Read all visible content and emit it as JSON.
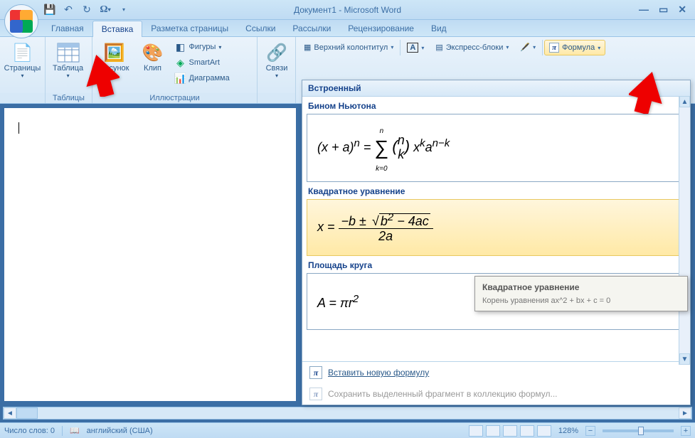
{
  "title": "Документ1 - Microsoft Word",
  "tabs": [
    "Главная",
    "Вставка",
    "Разметка страницы",
    "Ссылки",
    "Рассылки",
    "Рецензирование",
    "Вид"
  ],
  "active_tab": 1,
  "ribbon": {
    "pages": {
      "label": "Страницы"
    },
    "tables": {
      "label": "Таблица",
      "group": "Таблицы"
    },
    "illus": {
      "pic": "Рисунок",
      "clip": "Клип",
      "shapes": "Фигуры",
      "smartart": "SmartArt",
      "chart": "Диаграмма",
      "group": "Иллюстрации"
    },
    "links": {
      "label": "Связи"
    },
    "header": "Верхний колонтитул",
    "quickparts": "Экспресс-блоки",
    "formula": "Формула"
  },
  "gallery": {
    "header": "Встроенный",
    "items": [
      {
        "title": "Бином Ньютона",
        "formula_html": "(<i>x</i> + <i>a</i>)<sup><i>n</i></sup> = <span class='math-frac' style='vertical-align:middle'><span style='font-size:10px'><i>n</i></span><br><span class='math-sum'>∑</span><br><span style='font-size:10px'><i>k</i>=0</span></span> <span style='font-size:22px'>(</span><span class='binom'><i>n</i><br><i>k</i></span><span style='font-size:22px'>)</span> <i>x</i><sup><i>k</i></sup><i>a</i><sup><i>n</i>−<i>k</i></sup>"
      },
      {
        "title": "Квадратное уравнение",
        "hover": true,
        "formula_html": "<i>x</i> = <span class='math-frac'><span class='num'>−<i>b</i> ± <span class='sqrt'><span class='rad'><i>b</i><sup>2</sup> − 4<i>ac</i></span></span></span><br><span class='den'>2<i>a</i></span></span>"
      },
      {
        "title": "Площадь круга",
        "formula_html": "<i>A</i> = <i>πr</i><sup>2</sup>"
      }
    ],
    "footer": {
      "insert": "Вставить новую формулу",
      "save": "Сохранить выделенный фрагмент в коллекцию формул..."
    }
  },
  "tooltip": {
    "title": "Квадратное уравнение",
    "body": "Корень уравнения ax^2 + bx + c = 0"
  },
  "status": {
    "words_label": "Число слов:",
    "words": "0",
    "lang": "английский (США)",
    "zoom": "128%"
  },
  "chart_data": null
}
